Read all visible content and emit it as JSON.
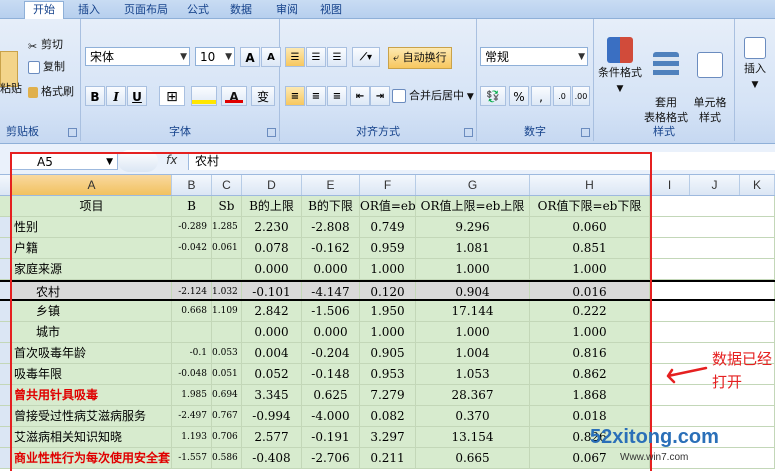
{
  "tabs": [
    "开始",
    "插入",
    "页面布局",
    "公式",
    "数据",
    "审阅",
    "视图"
  ],
  "clipboard": {
    "paste": "粘贴",
    "cut": "剪切",
    "copy": "复制",
    "format_painter": "格式刷",
    "label": "剪贴板"
  },
  "font": {
    "name": "宋体",
    "size": "10",
    "bold": "B",
    "italic": "I",
    "underline": "U",
    "grow": "A",
    "shrink": "A",
    "phonetic": "变",
    "label": "字体"
  },
  "alignment": {
    "wrap": "自动换行",
    "merge": "合并后居中",
    "label": "对齐方式"
  },
  "number": {
    "format": "常规",
    "percent": "%",
    "comma": ",",
    "label": "数字"
  },
  "styles": {
    "conditional": "条件格式",
    "table": "套用\n表格格式",
    "cell": "单元格\n样式",
    "label": "样式"
  },
  "insert": {
    "label": "插入"
  },
  "formula_bar": {
    "name_box": "A5",
    "fx": "fx",
    "content": "农村"
  },
  "columns": [
    "A",
    "B",
    "C",
    "D",
    "E",
    "F",
    "G",
    "H",
    "I",
    "J",
    "K"
  ],
  "header": [
    "项目",
    "B",
    "Sb",
    "B的上限",
    "B的下限",
    "OR值=eb",
    "OR值上限=eb上限",
    "OR值下限=eb下限"
  ],
  "rows": [
    {
      "a": "性别",
      "b": "-0.289",
      "sb": "1.285",
      "d": "2.230",
      "e": "-2.808",
      "f": "0.749",
      "g": "9.296",
      "h": "0.060",
      "style": "green"
    },
    {
      "a": "户籍",
      "b": "-0.042",
      "sb": "0.061",
      "d": "0.078",
      "e": "-0.162",
      "f": "0.959",
      "g": "1.081",
      "h": "0.851",
      "style": "green"
    },
    {
      "a": "家庭来源",
      "b": "",
      "sb": "",
      "d": "0.000",
      "e": "0.000",
      "f": "1.000",
      "g": "1.000",
      "h": "1.000",
      "style": "green"
    },
    {
      "a": "农村",
      "b": "-2.124",
      "sb": "1.032",
      "d": "-0.101",
      "e": "-4.147",
      "f": "0.120",
      "g": "0.904",
      "h": "0.016",
      "style": "selected"
    },
    {
      "a": "乡镇",
      "b": "0.668",
      "sb": "1.109",
      "d": "2.842",
      "e": "-1.506",
      "f": "1.950",
      "g": "17.144",
      "h": "0.222",
      "style": "green"
    },
    {
      "a": "城市",
      "b": "",
      "sb": "",
      "d": "0.000",
      "e": "0.000",
      "f": "1.000",
      "g": "1.000",
      "h": "1.000",
      "style": "green"
    },
    {
      "a": "首次吸毒年龄",
      "b": "-0.1",
      "sb": "0.053",
      "d": "0.004",
      "e": "-0.204",
      "f": "0.905",
      "g": "1.004",
      "h": "0.816",
      "style": "green"
    },
    {
      "a": "吸毒年限",
      "b": "-0.048",
      "sb": "0.051",
      "d": "0.052",
      "e": "-0.148",
      "f": "0.953",
      "g": "1.053",
      "h": "0.862",
      "style": "green"
    },
    {
      "a": "曾共用针具吸毒",
      "b": "1.985",
      "sb": "0.694",
      "d": "3.345",
      "e": "0.625",
      "f": "7.279",
      "g": "28.367",
      "h": "1.868",
      "style": "red"
    },
    {
      "a": "曾接受过性病艾滋病服务",
      "b": "-2.497",
      "sb": "0.767",
      "d": "-0.994",
      "e": "-4.000",
      "f": "0.082",
      "g": "0.370",
      "h": "0.018",
      "style": "green"
    },
    {
      "a": "艾滋病相关知识知晓",
      "b": "1.193",
      "sb": "0.706",
      "d": "2.577",
      "e": "-0.191",
      "f": "3.297",
      "g": "13.154",
      "h": "0.826",
      "style": "green"
    },
    {
      "a": "商业性性行为每次使用安全套",
      "b": "-1.557",
      "sb": "0.586",
      "d": "-0.408",
      "e": "-2.706",
      "f": "0.211",
      "g": "0.665",
      "h": "0.067",
      "style": "red"
    }
  ],
  "annotation": {
    "line1": "数据已经",
    "line2": "打开"
  },
  "watermark": {
    "main": "52xitong.com",
    "sub": "Www.win7.com"
  },
  "colors": {
    "row_fill": "#d7ebce",
    "selected_fill": "#d9d9d9",
    "highlight_box": "#e52020",
    "emphasis_text": "#e00000"
  }
}
